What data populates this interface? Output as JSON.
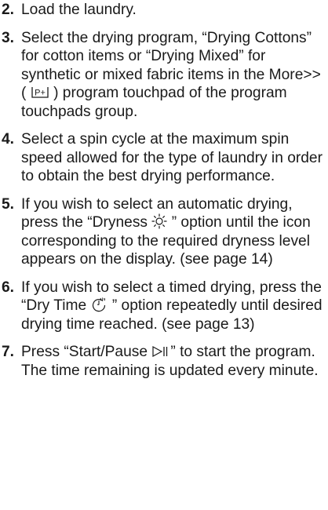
{
  "steps": [
    {
      "number": "2.",
      "text": "Load the laundry."
    },
    {
      "number": "3.",
      "text_before_icon": "Select the drying program, “Drying Cottons” for cotton items or “Drying Mixed” for synthetic or mixed fabric items in the More>> ( ",
      "icon": "p-plus-icon",
      "text_after_icon": " ) program touchpad of the program touchpads group."
    },
    {
      "number": "4.",
      "text": "Select a spin cycle at the maximum spin speed allowed for the type of laundry in order to obtain the best drying performance."
    },
    {
      "number": "5.",
      "text_before_icon": "If you wish to select an automatic drying, press the “Dryness ",
      "icon": "sun-icon",
      "text_after_icon": " ” option until the icon corresponding to the required dryness level appears on the display. (see page 14)"
    },
    {
      "number": "6.",
      "text_before_icon": "If you wish to select a timed drying, press the “Dry Time ",
      "icon": "dry-time-clock-icon",
      "text_after_icon": " ” option repeatedly until desired drying time reached. (see page 13)"
    },
    {
      "number": "7.",
      "text_before_icon": "Press “Start/Pause ",
      "icon": "start-pause-icon",
      "text_after_icon": "” to start the program. The time remaining is updated every minute."
    }
  ],
  "icon_label": "P+"
}
